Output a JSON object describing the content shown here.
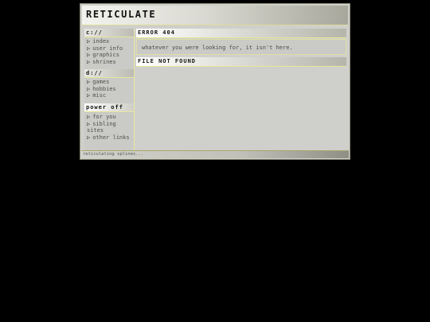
{
  "site": {
    "title": "RETICULATE"
  },
  "sidebar": {
    "bullet_icon": "triangle-right-outline-icon",
    "sections": [
      {
        "heading": "c://",
        "items": [
          "index",
          "user info",
          "graphics",
          "shrines"
        ]
      },
      {
        "heading": "d://",
        "items": [
          "games",
          "hobbies",
          "misc"
        ]
      },
      {
        "heading": "power off",
        "items": [
          "for you",
          "sibling sites",
          "other links"
        ]
      }
    ]
  },
  "main": {
    "error": {
      "heading": "ERROR 404",
      "message": "whatever you were looking for, it isn't here."
    },
    "notfound": {
      "heading": "FILE NOT FOUND"
    }
  },
  "status": {
    "text": "reticulating splines..."
  },
  "colors": {
    "background": "#000000",
    "panel": "#cfcfcb",
    "accent_border": "#e6e69a"
  }
}
